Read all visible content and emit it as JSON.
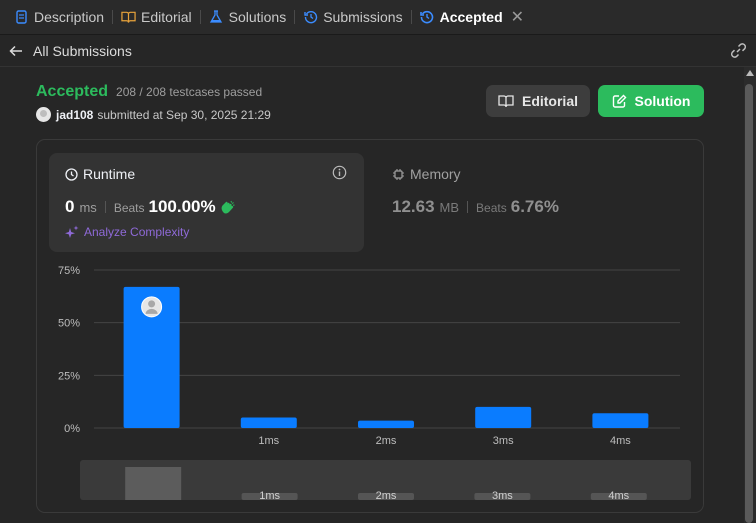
{
  "tabs": [
    {
      "label": "Description",
      "icon": "description-icon",
      "active": false
    },
    {
      "label": "Editorial",
      "icon": "book-icon",
      "active": false
    },
    {
      "label": "Solutions",
      "icon": "flask-icon",
      "active": false
    },
    {
      "label": "Submissions",
      "icon": "history-icon",
      "active": false
    },
    {
      "label": "Accepted",
      "icon": "history-icon",
      "active": true
    }
  ],
  "subheader": {
    "back_label": "All Submissions"
  },
  "result": {
    "status": "Accepted",
    "testcases": "208 / 208 testcases passed",
    "username": "jad108",
    "submitted_text": "submitted at Sep 30, 2025 21:29"
  },
  "buttons": {
    "editorial": "Editorial",
    "solution": "Solution"
  },
  "runtime": {
    "title": "Runtime",
    "value": "0",
    "unit": "ms",
    "beats_label": "Beats",
    "beats_value": "100.00%",
    "analyze": "Analyze Complexity"
  },
  "memory": {
    "title": "Memory",
    "value": "12.63",
    "unit": "MB",
    "beats_label": "Beats",
    "beats_value": "6.76%"
  },
  "colors": {
    "accent_green": "#2cbb5d",
    "bar_blue": "#0a7cff",
    "active_tab_icon": "#3b8cff",
    "analyze_purple": "#8f6ad8"
  },
  "chart_data": {
    "type": "bar",
    "categories": [
      "",
      "1ms",
      "2ms",
      "3ms",
      "4ms"
    ],
    "values": [
      67,
      5,
      3.5,
      10,
      7
    ],
    "ylim": [
      0,
      75
    ],
    "yticks": [
      "0%",
      "25%",
      "50%",
      "75%"
    ],
    "ytick_values": [
      0,
      25,
      50,
      75
    ],
    "grid": true,
    "highlight_index": 0,
    "navigator_labels": [
      "1ms",
      "2ms",
      "3ms",
      "4ms"
    ]
  }
}
